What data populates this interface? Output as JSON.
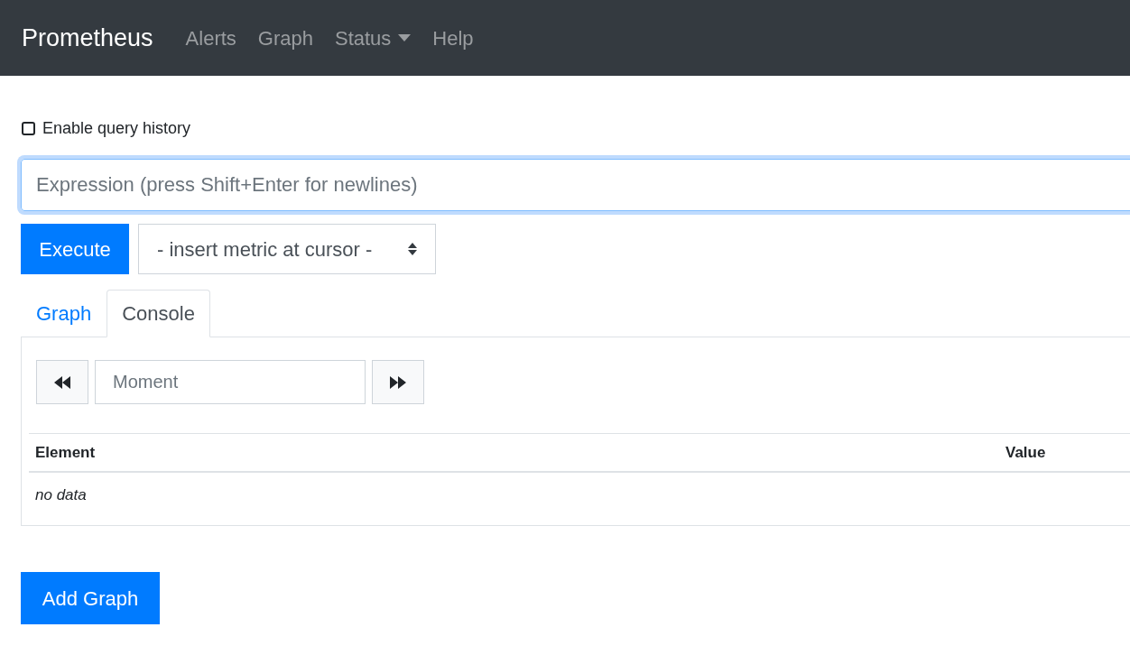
{
  "navbar": {
    "brand": "Prometheus",
    "links": [
      {
        "label": "Alerts",
        "kind": "link"
      },
      {
        "label": "Graph",
        "kind": "link"
      },
      {
        "label": "Status",
        "kind": "dropdown"
      },
      {
        "label": "Help",
        "kind": "link"
      }
    ]
  },
  "history": {
    "label": "Enable query history",
    "checked": false
  },
  "expression": {
    "placeholder": "Expression (press Shift+Enter for newlines)"
  },
  "execute": "Execute",
  "metric_select": {
    "value": "- insert metric at cursor -"
  },
  "tabs": [
    {
      "label": "Graph",
      "selected": false
    },
    {
      "label": "Console",
      "selected": true
    }
  ],
  "moment": {
    "placeholder": "Moment"
  },
  "table": {
    "columns": [
      "Element",
      "Value"
    ],
    "empty": "no data"
  },
  "add_graph": "Add Graph"
}
